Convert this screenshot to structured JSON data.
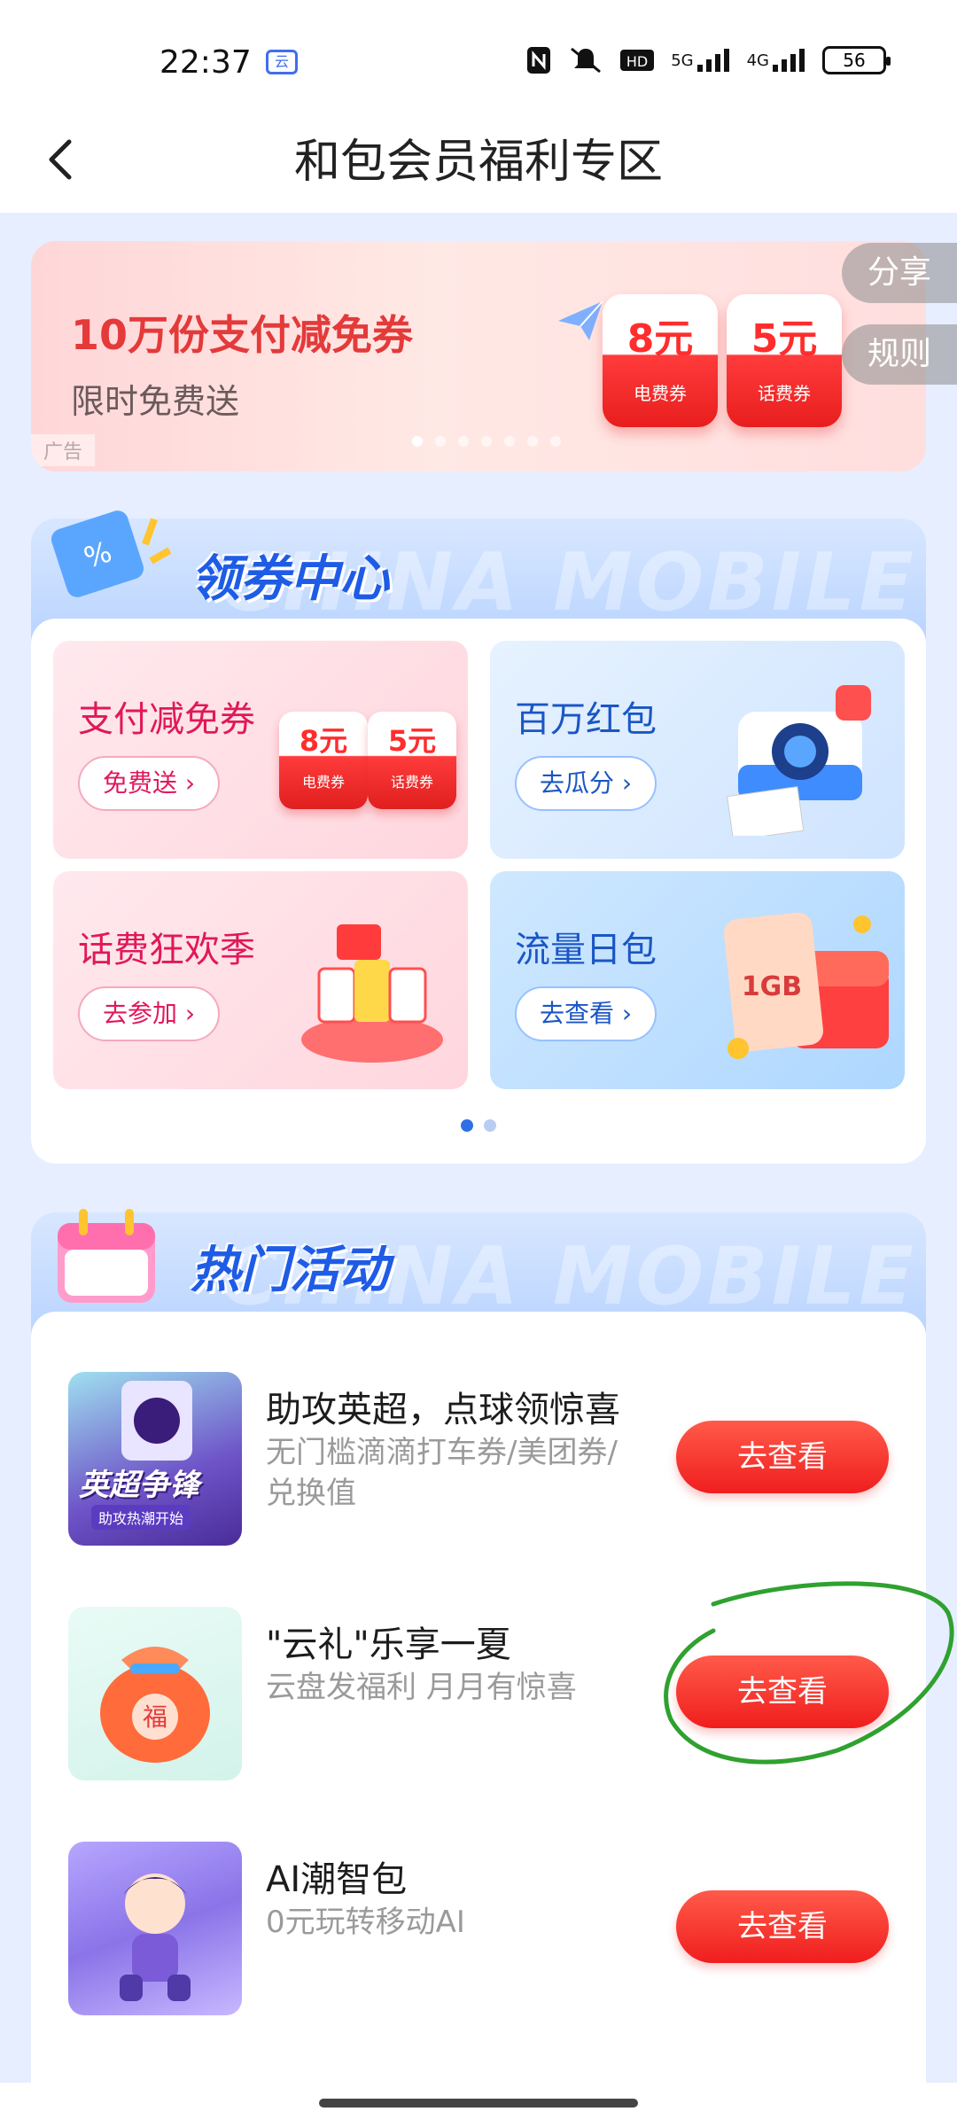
{
  "status_bar": {
    "time": "22:37",
    "app_badge": "云",
    "network_hd": "HD2",
    "network_5g": "5G",
    "network_4g": "4G",
    "battery": "56"
  },
  "header": {
    "title": "和包会员福利专区"
  },
  "banner": {
    "title": "10万份支付减免券",
    "subtitle": "限时免费送",
    "ad_tag": "广告",
    "coupons": [
      {
        "value": "8元",
        "label": "电费券"
      },
      {
        "value": "5元",
        "label": "话费券"
      }
    ],
    "share_label": "分享",
    "rules_label": "规则"
  },
  "coupon_center": {
    "title": "领券中心",
    "watermark": "CHINA MOBILE",
    "cards": [
      {
        "title": "支付减免券",
        "button": "免费送 ›",
        "coupons": [
          {
            "value": "8元",
            "label": "电费券"
          },
          {
            "value": "5元",
            "label": "话费券"
          }
        ]
      },
      {
        "title": "百万红包",
        "button": "去瓜分 ›"
      },
      {
        "title": "话费狂欢季",
        "button": "去参加 ›"
      },
      {
        "title": "流量日包",
        "button": "去查看 ›",
        "badge": "1GB"
      }
    ]
  },
  "hot_activities": {
    "title": "热门活动",
    "watermark": "CHINA MOBILE",
    "items": [
      {
        "title": "助攻英超，点球领惊喜",
        "desc": "无门槛滴滴打车券/美团券/兑换值",
        "button": "去查看",
        "thumb_text": "英超争锋",
        "thumb_sub": "助攻热潮开始"
      },
      {
        "title": "\"云礼\"乐享一夏",
        "desc": "云盘发福利 月月有惊喜",
        "button": "去查看",
        "thumb_text": "福"
      },
      {
        "title": "AI潮智包",
        "desc": "0元玩转移动AI",
        "button": "去查看"
      }
    ]
  }
}
